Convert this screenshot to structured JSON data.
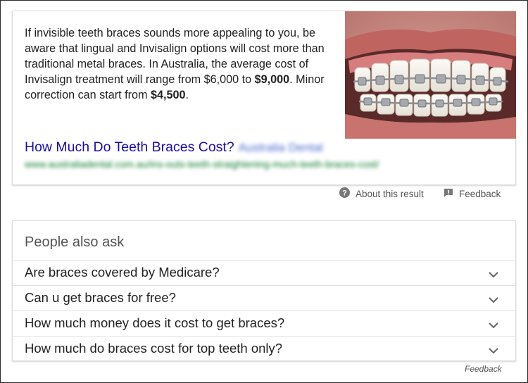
{
  "snippet": {
    "text_1": "If invisible teeth braces sounds more appealing to you, be aware that lingual and Invisalign options will cost more than traditional metal braces. In Australia, the average cost of Invisalign treatment will range from $6,000 to ",
    "text_bold_1": "$9,000",
    "text_2": ". Minor correction can start from ",
    "text_bold_2": "$4,500",
    "text_3": ".",
    "link_title": "How Much Do Teeth Braces Cost?",
    "link_source": "Australia Dental",
    "url": "www.australiadental.com.au/ins-outs-teeth-straightening-much-teeth-braces-cost/"
  },
  "result_meta": {
    "about_label": "About this result",
    "feedback_label": "Feedback"
  },
  "people_also_ask": {
    "title": "People also ask",
    "questions": [
      "Are braces covered by Medicare?",
      "Can u get braces for free?",
      "How much money does it cost to get braces?",
      "How much do braces cost for top teeth only?"
    ]
  },
  "bottom_feedback": "Feedback",
  "colors": {
    "link": "#1a0dab",
    "url": "#0a7a2a",
    "text": "#222222",
    "muted": "#555555"
  }
}
